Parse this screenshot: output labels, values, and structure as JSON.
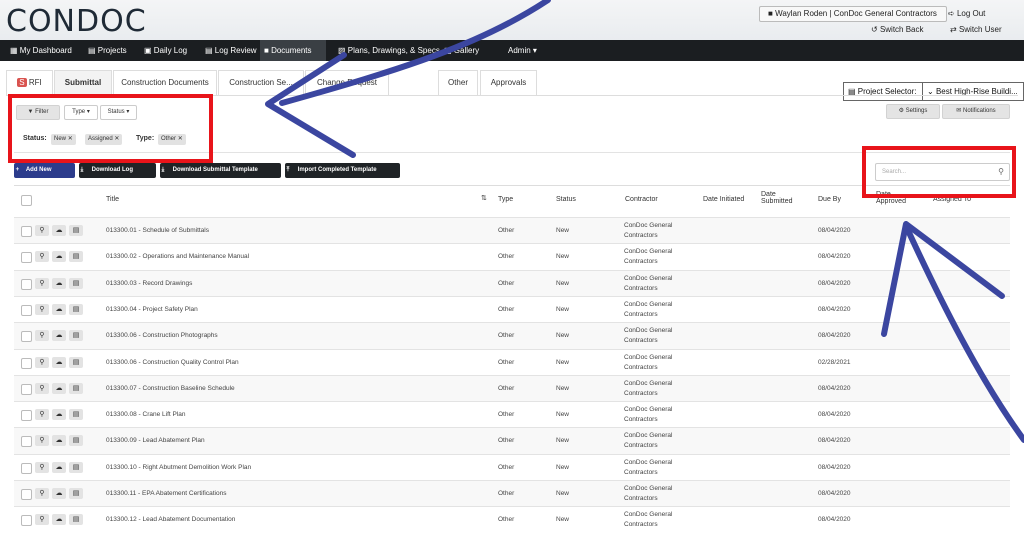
{
  "header": {
    "logo": "CONDOC",
    "user": "Waylan Roden | ConDoc General Contractors",
    "logout": "Log Out",
    "switch_back": "Switch Back",
    "switch_user": "Switch User"
  },
  "nav": {
    "items": [
      "My Dashboard",
      "Projects",
      "Daily Log",
      "Log Review",
      "Documents",
      "Plans, Drawings, & Specs",
      "Gallery",
      "Admin"
    ],
    "project_selector_label": "Project Selector:",
    "project_selector_value": "Best High-Rise Buildi..."
  },
  "tabs": [
    "RFI",
    "Submittal",
    "Construction Documents",
    "Construction Se...",
    "Change Request",
    "Other",
    "Approvals"
  ],
  "filters": {
    "filter": "Filter",
    "type": "Type",
    "status": "Status",
    "settings": "Settings",
    "notifications": "Notifications",
    "status_label": "Status:",
    "status_chips": [
      "New",
      "Assigned"
    ],
    "type_label": "Type:",
    "type_chips": [
      "Other"
    ]
  },
  "actions": {
    "add_new": "Add New",
    "download_log": "Download Log",
    "download_template": "Download Submittal Template",
    "import_template": "Import Completed Template",
    "search_placeholder": "Search..."
  },
  "table": {
    "headers": {
      "title": "Title",
      "type": "Type",
      "status": "Status",
      "contractor": "Contractor",
      "date_initiated": "Date Initiated",
      "date_submitted": "Date Submitted",
      "due_by": "Due By",
      "date_approved": "Date Approved",
      "assigned_to": "Assigned To"
    },
    "rows": [
      {
        "title": "013300.01 - Schedule of Submittals",
        "type": "Other",
        "status": "New",
        "contractor": "ConDoc General Contractors",
        "due": "08/04/2020"
      },
      {
        "title": "013300.02 - Operations and Maintenance Manual",
        "type": "Other",
        "status": "New",
        "contractor": "ConDoc General Contractors",
        "due": "08/04/2020"
      },
      {
        "title": "013300.03 - Record Drawings",
        "type": "Other",
        "status": "New",
        "contractor": "ConDoc General Contractors",
        "due": "08/04/2020"
      },
      {
        "title": "013300.04 - Project Safety Plan",
        "type": "Other",
        "status": "New",
        "contractor": "ConDoc General Contractors",
        "due": "08/04/2020"
      },
      {
        "title": "013300.06 - Construction Photographs",
        "type": "Other",
        "status": "New",
        "contractor": "ConDoc General Contractors",
        "due": "08/04/2020"
      },
      {
        "title": "013300.06 - Construction Quality Control Plan",
        "type": "Other",
        "status": "New",
        "contractor": "ConDoc General Contractors",
        "due": "02/28/2021"
      },
      {
        "title": "013300.07 - Construction Baseline Schedule",
        "type": "Other",
        "status": "New",
        "contractor": "ConDoc General Contractors",
        "due": "08/04/2020"
      },
      {
        "title": "013300.08 - Crane Lift Plan",
        "type": "Other",
        "status": "New",
        "contractor": "ConDoc General Contractors",
        "due": "08/04/2020"
      },
      {
        "title": "013300.09 - Lead Abatement Plan",
        "type": "Other",
        "status": "New",
        "contractor": "ConDoc General Contractors",
        "due": "08/04/2020"
      },
      {
        "title": "013300.10 - Right Abutment Demolition Work Plan",
        "type": "Other",
        "status": "New",
        "contractor": "ConDoc General Contractors",
        "due": "08/04/2020"
      },
      {
        "title": "013300.11 - EPA Abatement Certifications",
        "type": "Other",
        "status": "New",
        "contractor": "ConDoc General Contractors",
        "due": "08/04/2020"
      },
      {
        "title": "013300.12 - Lead Abatement Documentation",
        "type": "Other",
        "status": "New",
        "contractor": "ConDoc General Contractors",
        "due": "08/04/2020"
      }
    ]
  },
  "colors": {
    "accent": "#2c3c8c",
    "annotation_red": "#e8141a",
    "annotation_arrow": "#3b46a0"
  }
}
